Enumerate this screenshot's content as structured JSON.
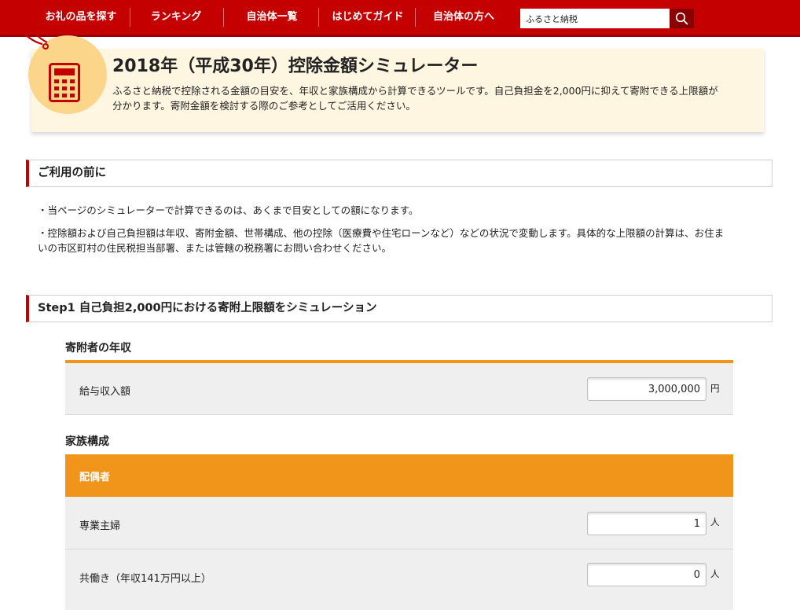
{
  "nav": {
    "items": [
      {
        "label": "お礼の品を探す"
      },
      {
        "label": "ランキング"
      },
      {
        "label": "自治体一覧"
      },
      {
        "label": "はじめてガイド"
      },
      {
        "label": "自治体の方へ"
      }
    ],
    "search": {
      "value": "ふるさと納税",
      "icon": "search-icon"
    }
  },
  "hero": {
    "icon": "calculator-icon",
    "title": "2018年（平成30年）控除金額シミュレーター",
    "description_line1": "ふるさと納税で控除される金額の目安を、年収と家族構成から計算できるツールです。自己負担金を2,000円に抑えて寄附できる上限額が",
    "description_line2": "分かります。寄附金額を検討する際のご参考としてご活用ください。"
  },
  "before_use": {
    "heading": "ご利用の前に",
    "note1": "・当ページのシミュレーターで計算できるのは、あくまで目安としての額になります。",
    "note2_line1": "・控除額および自己負担額は年収、寄附金額、世帯構成、他の控除（医療費や住宅ローンなど）などの状況で変動します。具体的な上限額の計算は、お住ま",
    "note2_line2": "いの市区町村の住民税担当部署、または管轄の税務署にお問い合わせください。"
  },
  "step1": {
    "heading": "Step1  自己負担2,000円における寄附上限額をシミュレーション",
    "income": {
      "title": "寄附者の年収",
      "salary_label": "給与収入額",
      "salary_value": "3,000,000",
      "salary_unit": "円"
    },
    "family": {
      "title": "家族構成",
      "spouse_header": "配偶者",
      "housewife_label": "専業主婦",
      "housewife_value": "1",
      "housewife_unit": "人",
      "dual_income_label": "共働き（年収141万円以上）",
      "dual_income_value": "0",
      "dual_income_unit": "人"
    }
  },
  "colors": {
    "brand_red": "#c40000",
    "accent_orange": "#f0941a",
    "hero_bg": "#fef6e0"
  }
}
